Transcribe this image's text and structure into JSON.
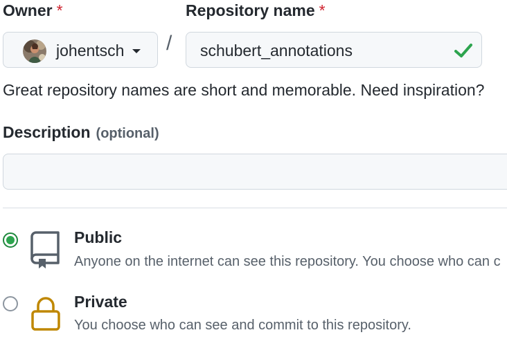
{
  "owner": {
    "label": "Owner",
    "required_mark": "*",
    "selected": "johentsch"
  },
  "repo": {
    "label": "Repository name",
    "required_mark": "*",
    "value": "schubert_annotations",
    "valid": true
  },
  "hint": "Great repository names are short and memorable. Need inspiration?",
  "description": {
    "label": "Description",
    "optional": "(optional)",
    "value": ""
  },
  "visibility": {
    "selected": "public",
    "options": [
      {
        "title": "Public",
        "description": "Anyone on the internet can see this repository. You choose who can c",
        "icon": "repo-icon"
      },
      {
        "title": "Private",
        "description": "You choose who can see and commit to this repository.",
        "icon": "lock-icon"
      }
    ]
  },
  "colors": {
    "required": "#cf222e",
    "valid_check": "#2da44e",
    "radio_selected": "#2da44e",
    "lock_icon": "#bf8700",
    "repo_icon": "#57606a"
  }
}
